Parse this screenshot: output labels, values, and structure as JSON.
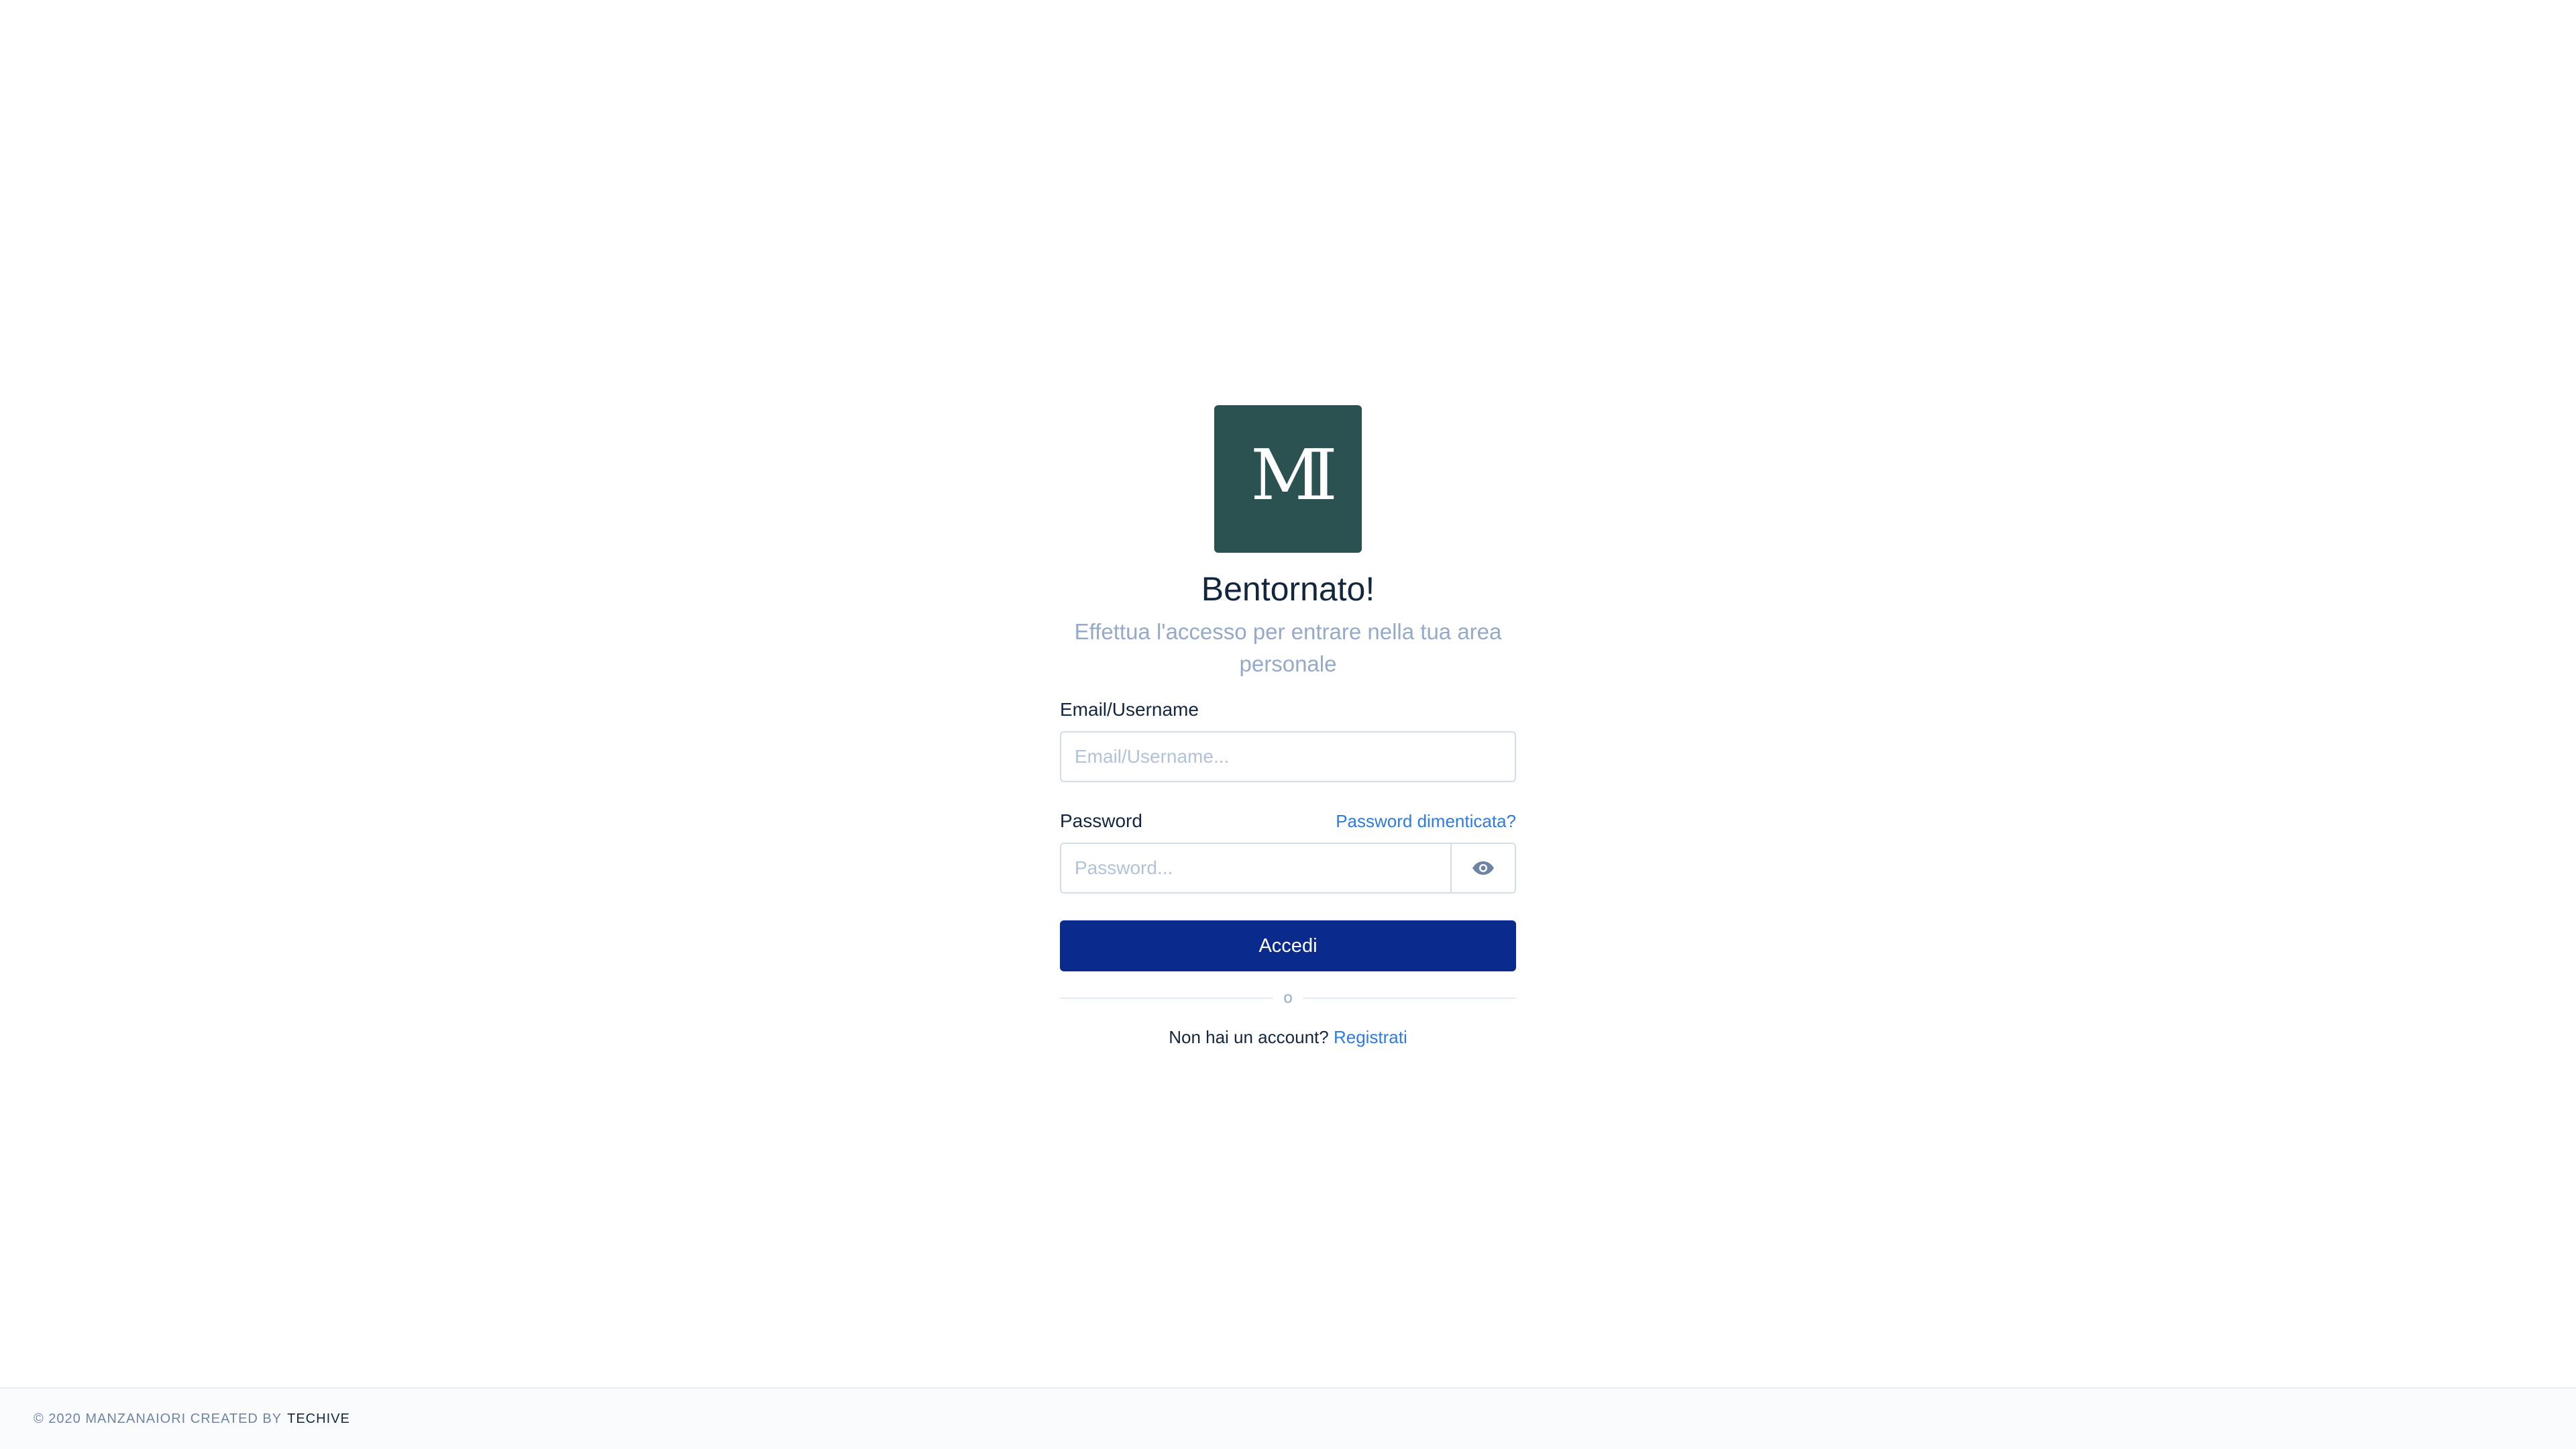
{
  "brand": {
    "logo_text": "MI",
    "logo_bg": "#2b5150",
    "logo_fg": "#ffffff"
  },
  "login": {
    "title": "Bentornato!",
    "subtitle": "Effettua l'accesso per entrare nella tua area personale",
    "email_label": "Email/Username",
    "email_placeholder": "Email/Username...",
    "email_value": "",
    "password_label": "Password",
    "password_placeholder": "Password...",
    "password_value": "",
    "forgot_link": "Password dimenticata?",
    "toggle_visibility_icon": "eye-icon",
    "submit_label": "Accedi",
    "divider_text": "o",
    "no_account_text": "Non hai un account?",
    "register_link": "Registrati"
  },
  "footer": {
    "copyright": "© 2020 MANZANAIORI CREATED BY",
    "brand": "TECHIVE"
  },
  "colors": {
    "primary_button": "#0a2a8e",
    "link": "#2c7be5",
    "muted_text": "#95aac9",
    "heading": "#12263f",
    "input_border": "#d2ddec"
  }
}
